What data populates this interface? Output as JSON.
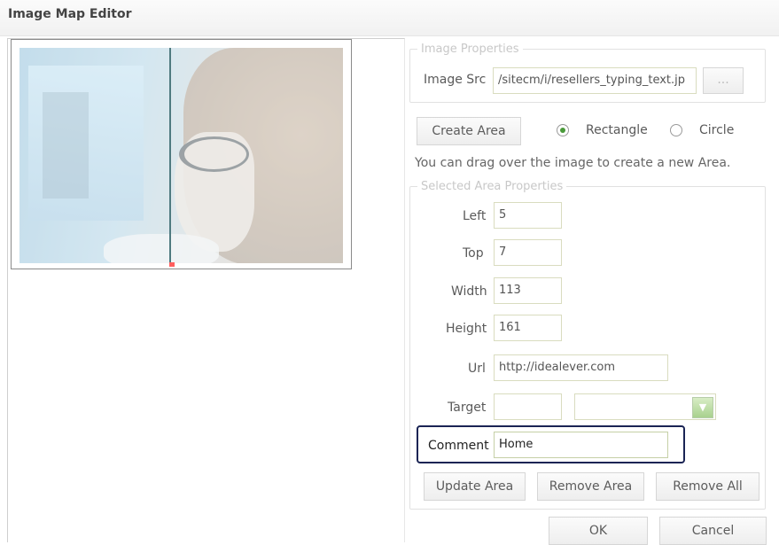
{
  "window": {
    "title": "Image Map Editor"
  },
  "image_properties": {
    "legend": "Image Properties",
    "src_label": "Image Src",
    "src_value": "/sitecm/i/resellers_typing_text.jp",
    "browse_label": "..."
  },
  "create": {
    "button_label": "Create Area",
    "shape_rectangle_label": "Rectangle",
    "shape_circle_label": "Circle",
    "selected_shape": "Rectangle",
    "hint": "You can drag over the image to create a new Area."
  },
  "selected_area": {
    "legend": "Selected Area Properties",
    "left_label": "Left",
    "left_value": "5",
    "top_label": "Top",
    "top_value": "7",
    "width_label": "Width",
    "width_value": "113",
    "height_label": "Height",
    "height_value": "161",
    "url_label": "Url",
    "url_value": "http://idealever.com",
    "target_label": "Target",
    "target_value": "",
    "target_select_value": "",
    "comment_label": "Comment",
    "comment_value": "Home"
  },
  "area_actions": {
    "update": "Update Area",
    "remove": "Remove Area",
    "remove_all": "Remove All"
  },
  "dialog_actions": {
    "ok": "OK",
    "cancel": "Cancel"
  },
  "colors": {
    "highlight_border": "#1a2454",
    "handle": "#ff5e5e",
    "radio_dot": "#4a9a3a"
  }
}
